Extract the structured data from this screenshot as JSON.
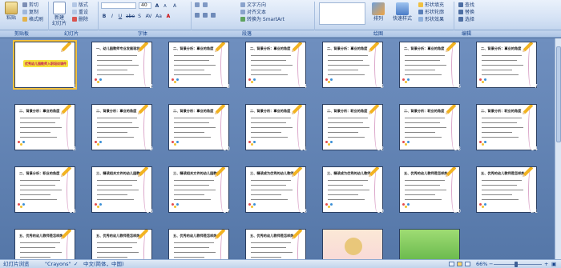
{
  "ribbon": {
    "clipboard": {
      "group_label": "剪贴板",
      "paste": "粘贴",
      "cut": "剪切",
      "copy": "复制",
      "format_painter": "格式刷"
    },
    "slides": {
      "group_label": "幻灯片",
      "new_slide": "新建\n幻灯片",
      "layout": "版式",
      "reset": "重设",
      "delete": "删除"
    },
    "font": {
      "group_label": "字体",
      "font_name": "",
      "font_size": "40",
      "bold": "B",
      "italic": "I",
      "underline": "U",
      "shadow": "S",
      "strike": "abe",
      "spacing": "AV",
      "case": "Aa",
      "grow": "A",
      "shrink": "A",
      "clear": "A",
      "color": "A"
    },
    "paragraph": {
      "group_label": "段落",
      "text_direction": "文字方向",
      "align_text": "对齐文本",
      "smartart": "转换为 SmartArt"
    },
    "drawing": {
      "group_label": "绘图",
      "arrange": "排列",
      "quick_styles": "快速样式",
      "shape_fill": "形状填充",
      "shape_outline": "形状轮廓",
      "shape_effects": "形状效果"
    },
    "editing": {
      "group_label": "编辑",
      "find": "查找",
      "replace": "替换",
      "select": "选择"
    }
  },
  "slides": [
    {
      "num": "1",
      "title": "优秀幼儿园教师入职培训课件",
      "type": "cover"
    },
    {
      "num": "2",
      "title": "一、幼儿园教师专业发展现状",
      "type": "list"
    },
    {
      "num": "3",
      "title": "二、背景分析：事业的角度",
      "type": "list"
    },
    {
      "num": "4",
      "title": "二、背景分析：事业的角度",
      "type": "list"
    },
    {
      "num": "5",
      "title": "二、背景分析：事业的角度",
      "type": "list"
    },
    {
      "num": "6",
      "title": "二、背景分析：事业的角度",
      "type": "list"
    },
    {
      "num": "7",
      "title": "二、背景分析：事业的角度",
      "type": "list"
    },
    {
      "num": "8",
      "title": "二、背景分析：事业的角度",
      "type": "list"
    },
    {
      "num": "9",
      "title": "二、背景分析：事业的角度",
      "type": "list"
    },
    {
      "num": "10",
      "title": "二、背景分析：事业的角度",
      "type": "list"
    },
    {
      "num": "11",
      "title": "二、背景分析：事业的角度",
      "type": "list"
    },
    {
      "num": "12",
      "title": "二、背景分析：职业的角度",
      "type": "list"
    },
    {
      "num": "13",
      "title": "二、背景分析：职业的角度",
      "type": "list"
    },
    {
      "num": "14",
      "title": "二、背景分析：职业的角度",
      "type": "list"
    },
    {
      "num": "15",
      "title": "二、背景分析：职业的角度",
      "type": "list"
    },
    {
      "num": "16",
      "title": "三、精读相关文件的幼儿园教师",
      "type": "list"
    },
    {
      "num": "17",
      "title": "三、精读相关文件的幼儿园教师",
      "type": "list"
    },
    {
      "num": "18",
      "title": "三、精读成为优秀的幼儿教师",
      "type": "list"
    },
    {
      "num": "19",
      "title": "三、精读成为优秀的幼儿教师",
      "type": "list"
    },
    {
      "num": "20",
      "title": "五、优秀的幼儿教师是怎样炼",
      "type": "list"
    },
    {
      "num": "21",
      "title": "五、优秀的幼儿教师是怎样炼",
      "type": "list"
    },
    {
      "num": "22",
      "title": "五、优秀的幼儿教师是怎样炼",
      "type": "list"
    },
    {
      "num": "23",
      "title": "五、优秀的幼儿教师是怎样炼",
      "type": "list"
    },
    {
      "num": "24",
      "title": "五、优秀的幼儿教师是怎样炼",
      "type": "list"
    },
    {
      "num": "25",
      "title": "五、优秀的幼儿教师是怎样炼",
      "type": "list"
    },
    {
      "num": "26",
      "title": "谢谢！",
      "type": "thanks"
    },
    {
      "num": "27",
      "title": "",
      "type": "green"
    }
  ],
  "status": {
    "view": "幻灯片浏览",
    "theme": "\"Crayons\"",
    "language": "中文(简体，中国)",
    "zoom": "66%"
  }
}
